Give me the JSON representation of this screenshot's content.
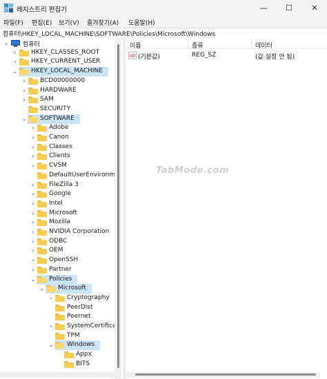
{
  "window": {
    "title": "레지스트리 편집기",
    "controls": {
      "minimize": "—",
      "maximize": "☐",
      "close": "✕"
    }
  },
  "menu": [
    "파일(F)",
    "편집(E)",
    "보기(V)",
    "즐겨찾기(A)",
    "도움말(H)"
  ],
  "address": "컴퓨터\\HKEY_LOCAL_MACHINE\\SOFTWARE\\Policies\\Microsoft\\Windows",
  "tree": [
    {
      "label": "컴퓨터",
      "level": 0,
      "arrow": "open",
      "icon": "computer-icon",
      "selected": false
    },
    {
      "label": "HKEY_CLASSES_ROOT",
      "level": 1,
      "arrow": "closed",
      "selected": false
    },
    {
      "label": "HKEY_CURRENT_USER",
      "level": 1,
      "arrow": "closed",
      "selected": false
    },
    {
      "label": "HKEY_LOCAL_MACHINE",
      "level": 1,
      "arrow": "open",
      "selected": true
    },
    {
      "label": "BCD00000000",
      "level": 2,
      "arrow": "closed",
      "selected": false
    },
    {
      "label": "HARDWARE",
      "level": 2,
      "arrow": "closed",
      "selected": false
    },
    {
      "label": "SAM",
      "level": 2,
      "arrow": "closed",
      "selected": false
    },
    {
      "label": "SECURITY",
      "level": 2,
      "arrow": "none",
      "selected": false
    },
    {
      "label": "SOFTWARE",
      "level": 2,
      "arrow": "open",
      "selected": true
    },
    {
      "label": "Adobe",
      "level": 3,
      "arrow": "closed",
      "selected": false
    },
    {
      "label": "Canon",
      "level": 3,
      "arrow": "closed",
      "selected": false
    },
    {
      "label": "Classes",
      "level": 3,
      "arrow": "closed",
      "selected": false
    },
    {
      "label": "Clients",
      "level": 3,
      "arrow": "closed",
      "selected": false
    },
    {
      "label": "CVSM",
      "level": 3,
      "arrow": "closed",
      "selected": false
    },
    {
      "label": "DefaultUserEnvironment",
      "level": 3,
      "arrow": "none",
      "selected": false
    },
    {
      "label": "FileZilla 3",
      "level": 3,
      "arrow": "closed",
      "selected": false
    },
    {
      "label": "Google",
      "level": 3,
      "arrow": "closed",
      "selected": false
    },
    {
      "label": "Intel",
      "level": 3,
      "arrow": "closed",
      "selected": false
    },
    {
      "label": "Microsoft",
      "level": 3,
      "arrow": "closed",
      "selected": false
    },
    {
      "label": "Mozilla",
      "level": 3,
      "arrow": "closed",
      "selected": false
    },
    {
      "label": "NVIDIA Corporation",
      "level": 3,
      "arrow": "closed",
      "selected": false
    },
    {
      "label": "ODBC",
      "level": 3,
      "arrow": "closed",
      "selected": false
    },
    {
      "label": "OEM",
      "level": 3,
      "arrow": "closed",
      "selected": false
    },
    {
      "label": "OpenSSH",
      "level": 3,
      "arrow": "closed",
      "selected": false
    },
    {
      "label": "Partner",
      "level": 3,
      "arrow": "closed",
      "selected": false
    },
    {
      "label": "Policies",
      "level": 3,
      "arrow": "open",
      "selected": true
    },
    {
      "label": "Microsoft",
      "level": 4,
      "arrow": "open",
      "selected": true
    },
    {
      "label": "Cryptography",
      "level": 5,
      "arrow": "closed",
      "selected": false
    },
    {
      "label": "PeerDist",
      "level": 5,
      "arrow": "none",
      "selected": false
    },
    {
      "label": "Peernet",
      "level": 5,
      "arrow": "none",
      "selected": false
    },
    {
      "label": "SystemCertificates",
      "level": 5,
      "arrow": "closed",
      "selected": false
    },
    {
      "label": "TPM",
      "level": 5,
      "arrow": "none",
      "selected": false
    },
    {
      "label": "Windows",
      "level": 5,
      "arrow": "open",
      "selected": true
    },
    {
      "label": "Appx",
      "level": 6,
      "arrow": "none",
      "selected": false
    },
    {
      "label": "BITS",
      "level": 6,
      "arrow": "none",
      "selected": false
    }
  ],
  "list": {
    "columns": [
      "이름",
      "종류",
      "데이터"
    ],
    "rows": [
      {
        "name": "(기본값)",
        "type": "REG_SZ",
        "data": "(값 설정 안 됨)",
        "icon": "string-value-icon"
      }
    ]
  },
  "watermark": "TabMode.com",
  "colors": {
    "selection": "#cce4f7",
    "folder": "#f7cc52",
    "accent": "#2f7ad6"
  }
}
